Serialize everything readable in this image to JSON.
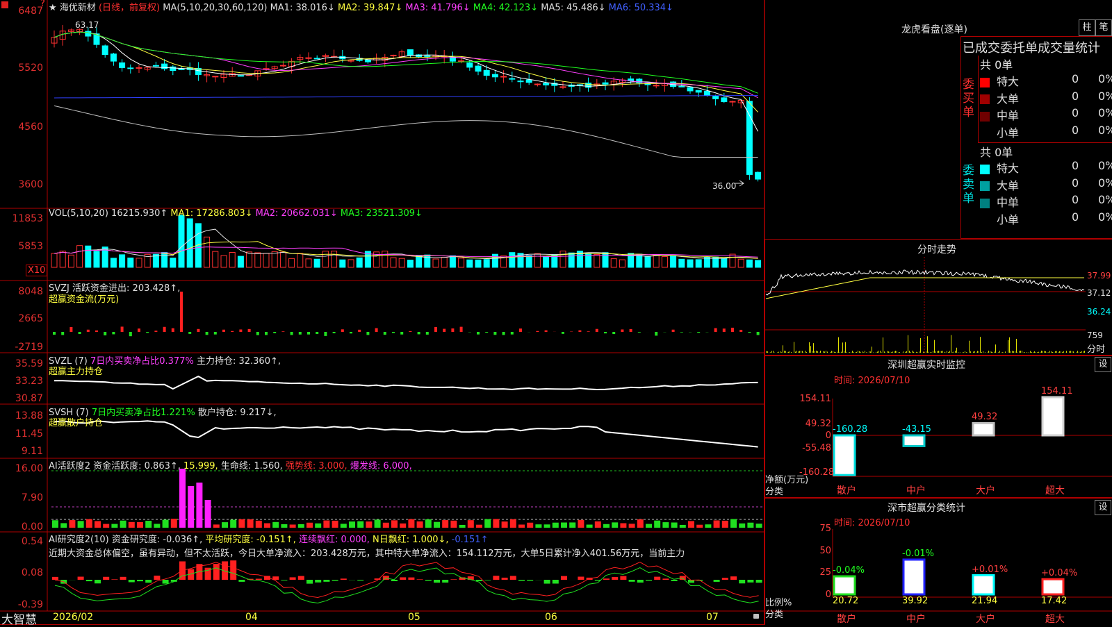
{
  "chart": {
    "title_star": "★",
    "stock_name": "海优新材",
    "period": "(日线，前复权)",
    "ma_line": {
      "label": "MA(5,10,20,30,60,120)",
      "ma1": "MA1: 38.016↓",
      "ma2": "MA2: 39.847↓",
      "ma3": "MA3: 41.796↓",
      "ma4": "MA4: 42.123↓",
      "ma5": "MA5: 45.486↓",
      "ma6": "MA6: 50.334↓"
    },
    "price_axis": [
      "6487",
      "5520",
      "4560",
      "3600"
    ],
    "high_label": "63.17",
    "low_label": "36.00",
    "vol_axis": [
      "11853",
      "5853"
    ],
    "vol_unit": "X10",
    "vol_line": {
      "label": "VOL(5,10,20)",
      "value": "16215.930↑",
      "ma1": "MA1: 17286.803↓",
      "ma2": "MA2: 20662.031↓",
      "ma3": "MA3: 23521.309↓"
    },
    "svzj": {
      "label": "SVZJ",
      "text": "活跃资金进出: 203.428↑,",
      "sub": "超赢资金流(万元)",
      "axis": [
        "8048",
        "2665",
        "-2719"
      ]
    },
    "svzl": {
      "label": "SVZL (7)",
      "text1": "7日内买卖净占比0.377%",
      "text2": "主力持仓: 32.360↑,",
      "sub": "超赢主力持仓",
      "axis": [
        "35.59",
        "33.23",
        "30.87"
      ]
    },
    "svsh": {
      "label": "SVSH (7)",
      "text1": "7日内买卖净占比1.221%",
      "text2": "散户持仓: 9.217↓,",
      "sub": "超赢散户持仓",
      "axis": [
        "13.88",
        "11.45",
        "9.11"
      ]
    },
    "ai1": {
      "label": "AI活跃度2",
      "t1": "资金活跃度: 0.863↑,",
      "t2": "15.999,",
      "t3": "生命线: 1.560,",
      "t4": "强势线: 3.000,",
      "t5": "爆发线: 6.000,",
      "axis": [
        "16.00",
        "7.90",
        "0.00"
      ]
    },
    "ai2": {
      "label": "AI研究度2(10)",
      "t1": "资金研究度: -0.036↑,",
      "t2": "平均研究度: -0.151↑,",
      "t3": "连续飘红: 0.000,",
      "t4": "N日飘红: 1.000↓,",
      "t5": "-0.151↑",
      "comment": "近期大资金总体偏空，虽有异动，但不太活跃，今日大单净流入：203.428万元，其中特大单净流入：154.112万元，大单5日累计净入401.56万元，当前主力",
      "axis": [
        "0.54",
        "0.08",
        "-0.39"
      ]
    },
    "dates": [
      "2026/02",
      "04",
      "05",
      "06",
      "07"
    ],
    "brand": "大智慧"
  },
  "right_panel": {
    "longhu_title": "龙虎看盘(逐单)",
    "btn_bar": "柱",
    "btn_pen": "笔",
    "stats_title": "已成交委托单成交量统计",
    "buy": {
      "side_label": "委买单",
      "total": "共 0单",
      "rows": [
        {
          "name": "特大",
          "count": "0",
          "pct": "0%",
          "color": "#ff0000"
        },
        {
          "name": "大单",
          "count": "0",
          "pct": "0%",
          "color": "#a00000"
        },
        {
          "name": "中单",
          "count": "0",
          "pct": "0%",
          "color": "#700000"
        },
        {
          "name": "小单",
          "count": "0",
          "pct": "0%",
          "color": ""
        }
      ]
    },
    "sell": {
      "side_label": "委卖单",
      "total": "共 0单",
      "rows": [
        {
          "name": "特大",
          "count": "0",
          "pct": "0%",
          "color": "#00ffff"
        },
        {
          "name": "大单",
          "count": "0",
          "pct": "0%",
          "color": "#00a0a0"
        },
        {
          "name": "中单",
          "count": "0",
          "pct": "0%",
          "color": "#008080"
        },
        {
          "name": "小单",
          "count": "0",
          "pct": "0%",
          "color": ""
        }
      ]
    },
    "intraday": {
      "title": "分时走势",
      "axis": [
        "37.99",
        "37.12",
        "36.24"
      ],
      "vol_axis": "759",
      "vol_label": "分时"
    },
    "sz_monitor": {
      "title": "深圳超赢实时监控",
      "btn": "设",
      "time": "时间: 2026/07/10",
      "axis": [
        "154.11",
        "49.32",
        "0",
        "-55.48",
        "-160.28"
      ],
      "y_title": "净额(万元)",
      "x_title": "分类",
      "categories": [
        "散户",
        "中户",
        "大户",
        "超大"
      ],
      "values": [
        -160.28,
        -43.15,
        49.32,
        154.11
      ],
      "labels": [
        "-160.28",
        "-43.15",
        "49.32",
        "154.11"
      ]
    },
    "sz_class": {
      "title": "深市超赢分类统计",
      "btn": "设",
      "time": "时间: 2026/07/10",
      "axis": [
        "75",
        "50",
        "25",
        "0"
      ],
      "y_title": "比例%",
      "x_title": "分类",
      "categories": [
        "散户",
        "中户",
        "大户",
        "超大"
      ],
      "values": [
        20.72,
        39.92,
        21.94,
        17.42
      ],
      "values_text": [
        "20.72",
        "39.92",
        "21.94",
        "17.42"
      ],
      "changes": [
        "-0.04%",
        "-0.01%",
        "+0.01%",
        "+0.04%"
      ]
    }
  }
}
